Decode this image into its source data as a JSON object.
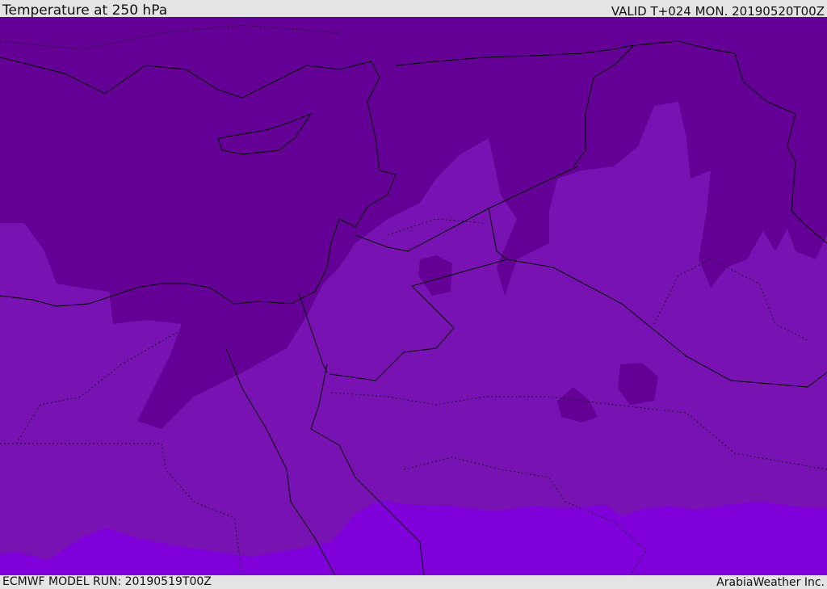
{
  "header": {
    "title": "Temperature at 250 hPa",
    "valid": "VALID T+024 MON. 20190520T00Z"
  },
  "footer": {
    "model_run": "ECMWF MODEL RUN: 20190519T00Z",
    "credit": "ArabiaWeather Inc."
  },
  "colors": {
    "cold_band": "#650096",
    "mid_band": "#7812b2",
    "warm_band": "#8000da",
    "coastline": "#000000"
  }
}
